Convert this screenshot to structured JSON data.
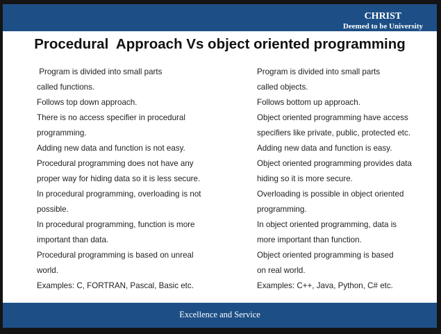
{
  "brand": {
    "name": "CHRIST",
    "subtitle": "Deemed to be University"
  },
  "title": "Procedural  Approach Vs object oriented programming",
  "left_column": [
    " Program is divided into small parts",
    "called functions.",
    "Follows top down approach.",
    "There is no access specifier in procedural",
    "programming.",
    "Adding new data and function is not easy.",
    "Procedural programming does not have any",
    "proper way for hiding data so it is less secure.",
    "In procedural programming, overloading is not",
    "possible.",
    "In procedural programming, function is more",
    "important than data.",
    "Procedural programming is based on unreal",
    "world.",
    "Examples: C, FORTRAN, Pascal, Basic etc."
  ],
  "right_column": [
    "Program is divided into small parts",
    "called objects.",
    "Follows bottom up approach.",
    "Object oriented programming have access",
    "specifiers like private, public, protected etc.",
    "Adding new data and function is easy.",
    "Object oriented programming provides data",
    "hiding so it is more secure.",
    "Overloading is possible in object oriented",
    "programming.",
    "In object oriented programming, data is",
    "more important than function.",
    "Object oriented programming is based",
    "on real world.",
    "Examples: C++, Java, Python, C# etc."
  ],
  "footer": "Excellence and Service",
  "colors": {
    "band": "#1d4f86",
    "text": "#1e1e1e",
    "title": "#111111"
  }
}
